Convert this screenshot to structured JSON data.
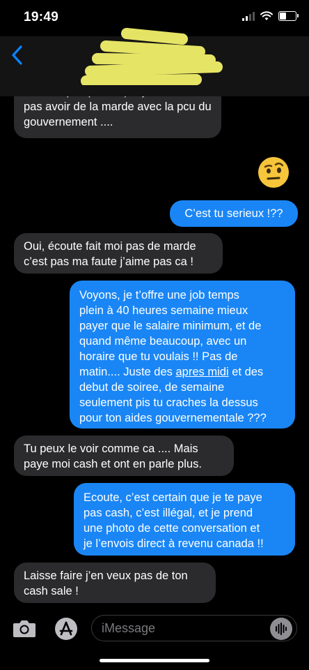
{
  "status": {
    "time": "19:49"
  },
  "messages": [
    {
      "side": "in",
      "text": "Declare pas parce que je veux pas avoir de la marde avec la pcu du gouvernement ...."
    },
    {
      "side": "out",
      "text": "🤨",
      "is_emoji": true
    },
    {
      "side": "out",
      "text": "C’est tu serieux !??"
    },
    {
      "side": "in",
      "lines": [
        "Oui, écoute fait moi pas de marde",
        "c’est pas ma faute j’aime pas ca !"
      ]
    },
    {
      "side": "out",
      "lines": [
        "Voyons, je t’offre une job temps",
        "plein à 40 heures semaine mieux",
        "payer que le salaire minimum, et de",
        "quand même beaucoup, avec un",
        "horaire que tu voulais !! Pas de",
        "matin.... Juste des",
        "apres midi",
        "et des",
        "debut de soiree, de semaine",
        "seulement pis tu craches la dessus",
        "pour ton aides gouvernementale ???"
      ]
    },
    {
      "side": "in",
      "lines": [
        "Tu peux le voir comme ca .... Mais",
        "paye moi cash et ont en parle plus."
      ]
    },
    {
      "side": "out",
      "lines": [
        "Ecoute, c’est certain que je te paye",
        "pas cash, c’est illégal, et je prend",
        "une photo de cette conversation et",
        "je l’envois direct à revenu canada !!"
      ]
    },
    {
      "side": "in",
      "lines": [
        "Laisse faire j’en veux pas de ton",
        "cash sale !"
      ]
    }
  ],
  "first_bubble": {
    "line1": "Declare pas parce que je veux",
    "line2": "pas avoir de la marde avec la pcu du",
    "line3": "gouvernement ...."
  },
  "composer": {
    "placeholder": "iMessage"
  },
  "colors": {
    "incoming": "#2b2b2d",
    "outgoing": "#1a86f5",
    "accent": "#0a84ff"
  }
}
